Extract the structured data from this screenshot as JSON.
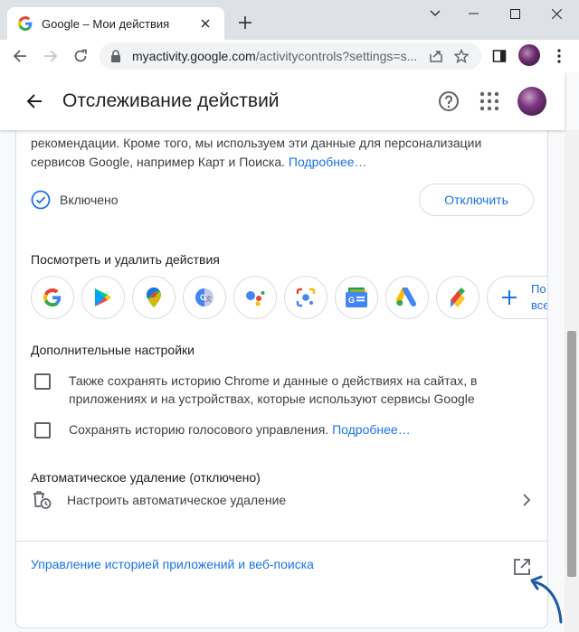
{
  "browser": {
    "tab_title": "Google – Мои действия",
    "url_host": "myactivity.google.com",
    "url_path": "/activitycontrols?settings=s..."
  },
  "page": {
    "title": "Отслеживание действий"
  },
  "card": {
    "description_line1": "рекомендации. Кроме того, мы используем эти данные для персонализации",
    "description_line2": "сервисов Google, например Карт и Поиска. ",
    "description_link": "Подробнее…",
    "status": "Включено",
    "disable_button": "Отключить",
    "view_delete_title": "Посмотреть и удалить действия",
    "apps": [
      "Google",
      "Google Play",
      "Google Maps",
      "Google Translate",
      "Google Assistant",
      "Google Lens",
      "Google News",
      "Google Ads",
      "Google Pay"
    ],
    "more_label_line1": "По",
    "more_label_line2": "все",
    "additional_title": "Дополнительные настройки",
    "chrome_history_label": "Также сохранять историю Chrome и данные о действиях на сайтах, в приложениях и на устройствах, которые используют сервисы Google",
    "voice_history_label": "Сохранять историю голосового управления. ",
    "voice_history_link": "Подробнее…",
    "auto_delete_title": "Автоматическое удаление (отключено)",
    "auto_delete_label": "Настроить автоматическое удаление",
    "manage_link": "Управление историей приложений и веб-поиска"
  },
  "colors": {
    "accent": "#1a73e8",
    "text": "#3c4043",
    "border": "#dadce0",
    "annotation_arrow": "#1e5aa8"
  }
}
